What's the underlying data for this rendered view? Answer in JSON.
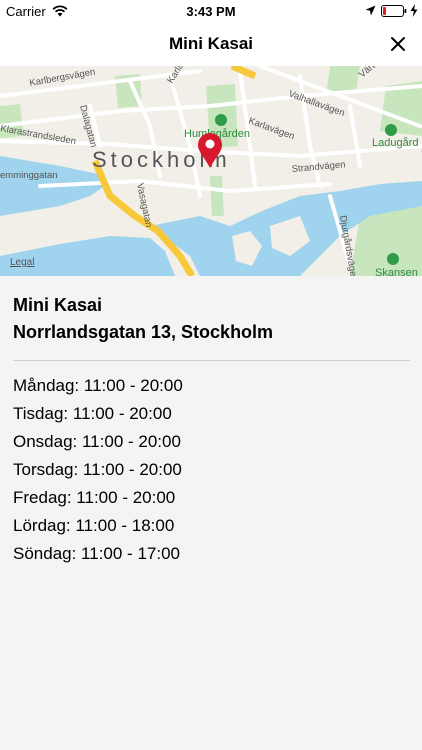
{
  "status_bar": {
    "carrier": "Carrier",
    "time": "3:43 PM",
    "icons": [
      "wifi-icon",
      "location-arrow-icon",
      "battery-icon",
      "charging-bolt-icon"
    ]
  },
  "nav": {
    "title": "Mini Kasai",
    "close_icon": "close-icon"
  },
  "map": {
    "city_label": "Stockholm",
    "legal": "Legal",
    "street_labels": {
      "karlbergsvagen": "Karlbergsvägen",
      "karlavagen_top": "Karlavägen",
      "karlavagen_mid": "Karlavägen",
      "valhallavagen": "Valhallavägen",
      "vartavagen": "Värtavägen",
      "dalagatan": "Dalagatan",
      "klarastrandsleden": "Klarastrandsleden",
      "emminggatan": "emminggatan",
      "vasagatan": "Vasagatan",
      "strandvagen": "Strandvägen",
      "djurgardsvagen": "Djurgårdsvägen"
    },
    "poi_labels": {
      "humlegarden": "Humlegården",
      "ladugardet": "Ladugård",
      "skansen": "Skansen"
    },
    "colors": {
      "land": "#f2efe8",
      "park": "#c8e6bd",
      "water": "#9fd3ee",
      "road_major": "#f7c93a",
      "pin": "#d7192e"
    }
  },
  "store": {
    "name": "Mini Kasai",
    "address": "Norrlandsgatan 13, Stockholm"
  },
  "opening_hours": [
    "Måndag: 11:00 - 20:00",
    "Tisdag: 11:00 - 20:00",
    "Onsdag: 11:00 - 20:00",
    "Torsdag: 11:00 - 20:00",
    "Fredag: 11:00 - 20:00",
    "Lördag: 11:00 - 18:00",
    "Söndag: 11:00 - 17:00"
  ]
}
